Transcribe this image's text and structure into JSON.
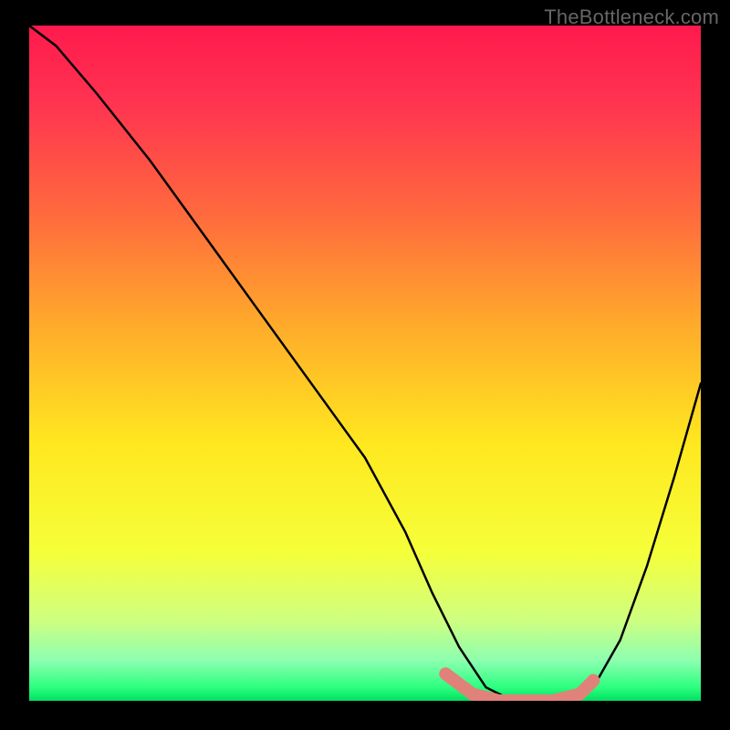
{
  "watermark": "TheBottleneck.com",
  "colors": {
    "background": "#000000",
    "gradient_stops": [
      {
        "offset": 0.0,
        "color": "#ff1a4d"
      },
      {
        "offset": 0.12,
        "color": "#ff3550"
      },
      {
        "offset": 0.28,
        "color": "#ff6a3d"
      },
      {
        "offset": 0.45,
        "color": "#ffad2a"
      },
      {
        "offset": 0.62,
        "color": "#ffe81f"
      },
      {
        "offset": 0.78,
        "color": "#f5ff3a"
      },
      {
        "offset": 0.88,
        "color": "#cfff80"
      },
      {
        "offset": 0.94,
        "color": "#8dffb0"
      },
      {
        "offset": 0.98,
        "color": "#2dff80"
      },
      {
        "offset": 1.0,
        "color": "#00e060"
      }
    ],
    "curve": "#000000",
    "highlight": "#e1827a"
  },
  "chart_data": {
    "type": "line",
    "title": "",
    "xlabel": "",
    "ylabel": "",
    "xlim": [
      0,
      100
    ],
    "ylim": [
      0,
      100
    ],
    "series": [
      {
        "name": "bottleneck-curve",
        "x": [
          0,
          4,
          10,
          18,
          26,
          34,
          42,
          50,
          56,
          60,
          64,
          68,
          72,
          76,
          80,
          84,
          88,
          92,
          96,
          100
        ],
        "values": [
          100,
          97,
          90,
          80,
          69,
          58,
          47,
          36,
          25,
          16,
          8,
          2,
          0,
          0,
          0,
          2,
          9,
          20,
          33,
          47
        ]
      }
    ],
    "highlight_segment": {
      "x": [
        62,
        66,
        70,
        74,
        78,
        82,
        84
      ],
      "values": [
        4,
        1,
        0,
        0,
        0,
        1,
        3
      ]
    }
  }
}
